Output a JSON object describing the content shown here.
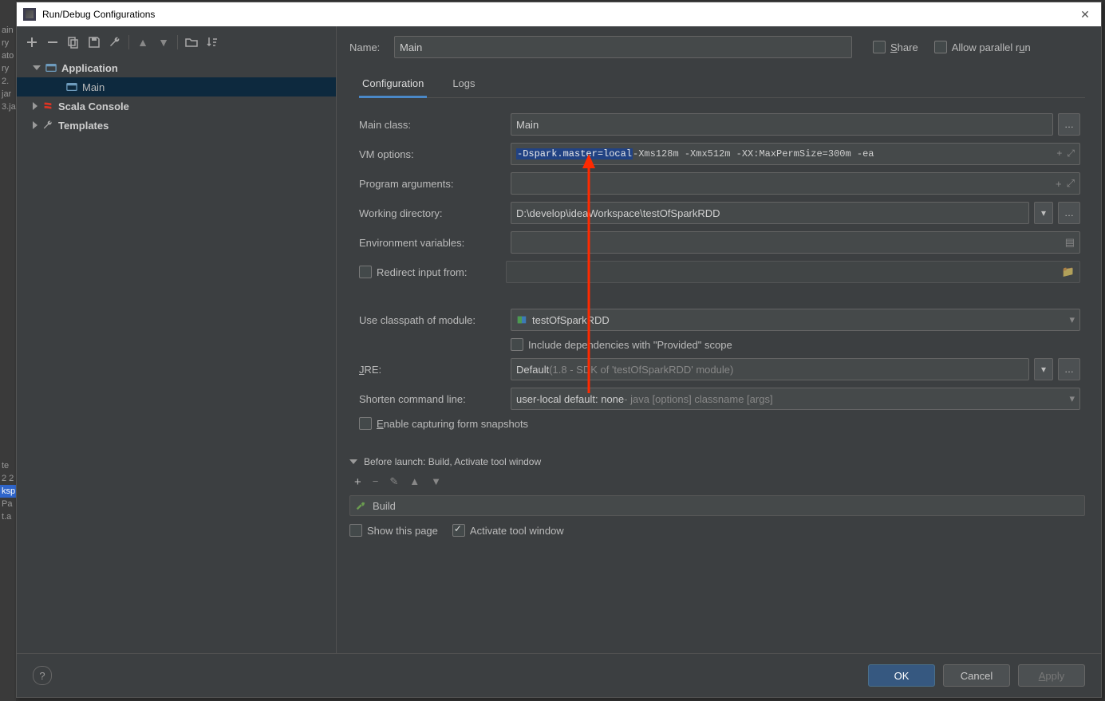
{
  "backstrip": [
    "ain",
    "ry",
    "ato",
    "ry",
    "2.",
    "jar",
    "3.ja",
    "",
    "",
    "",
    "",
    "",
    "",
    "",
    "",
    "",
    "",
    "",
    "",
    "",
    "",
    "",
    "",
    "",
    "",
    "te",
    "2 2",
    "ksp",
    "Pa",
    "t.a"
  ],
  "title": "Run/Debug Configurations",
  "tree": {
    "application": "Application",
    "main": "Main",
    "scala_console": "Scala Console",
    "templates": "Templates"
  },
  "topbar": {
    "name_label": "Name:",
    "name_value": "Main",
    "share": "Share",
    "parallel": "Allow parallel run"
  },
  "tabs": {
    "config": "Configuration",
    "logs": "Logs"
  },
  "form": {
    "main_class_label": "Main class:",
    "main_class_value": "Main",
    "vm_label": "VM options:",
    "vm_hl": "-Dspark.master=local",
    "vm_rest": " -Xms128m -Xmx512m -XX:MaxPermSize=300m -ea",
    "prog_args_label": "Program arguments:",
    "workdir_label": "Working directory:",
    "workdir_value": "D:\\develop\\ideaWorkspace\\testOfSparkRDD",
    "env_label": "Environment variables:",
    "redirect_label": "Redirect input from:",
    "classpath_label": "Use classpath of module:",
    "classpath_value": "testOfSparkRDD",
    "include_provided": "Include dependencies with \"Provided\" scope",
    "jre_label": "JRE:",
    "jre_value": "Default",
    "jre_hint": " (1.8 - SDK of 'testOfSparkRDD' module)",
    "shorten_label": "Shorten command line:",
    "shorten_value": "user-local default: none",
    "shorten_hint": " - java [options] classname [args]",
    "enable_capture": "Enable capturing form snapshots"
  },
  "before": {
    "header": "Before launch: Build, Activate tool window",
    "build": "Build",
    "show_page": "Show this page",
    "activate": "Activate tool window"
  },
  "footer": {
    "ok": "OK",
    "cancel": "Cancel",
    "apply": "Apply"
  }
}
